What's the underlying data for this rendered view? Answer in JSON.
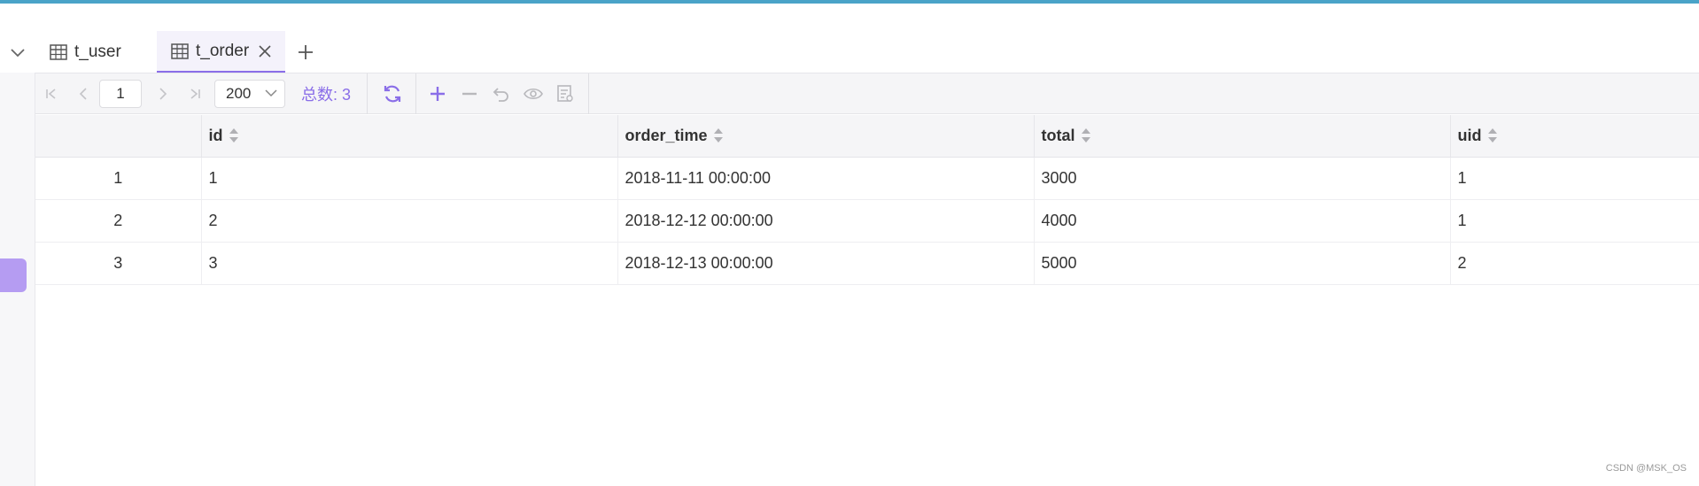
{
  "tabs": [
    {
      "label": "t_user",
      "active": false
    },
    {
      "label": "t_order",
      "active": true
    }
  ],
  "toolbar": {
    "page_value": "1",
    "page_size": "200",
    "total_label": "总数: 3"
  },
  "table": {
    "columns": [
      "id",
      "order_time",
      "total",
      "uid"
    ],
    "rows": [
      {
        "num": "1",
        "id": "1",
        "order_time": "2018-11-11 00:00:00",
        "total": "3000",
        "uid": "1"
      },
      {
        "num": "2",
        "id": "2",
        "order_time": "2018-12-12 00:00:00",
        "total": "4000",
        "uid": "1"
      },
      {
        "num": "3",
        "id": "3",
        "order_time": "2018-12-13 00:00:00",
        "total": "5000",
        "uid": "2"
      }
    ]
  },
  "watermark": "CSDN @MSK_OS",
  "colors": {
    "accent": "#8a6ee8",
    "top_bar": "#4aa3c8",
    "rail_marker": "#b59cf2"
  }
}
